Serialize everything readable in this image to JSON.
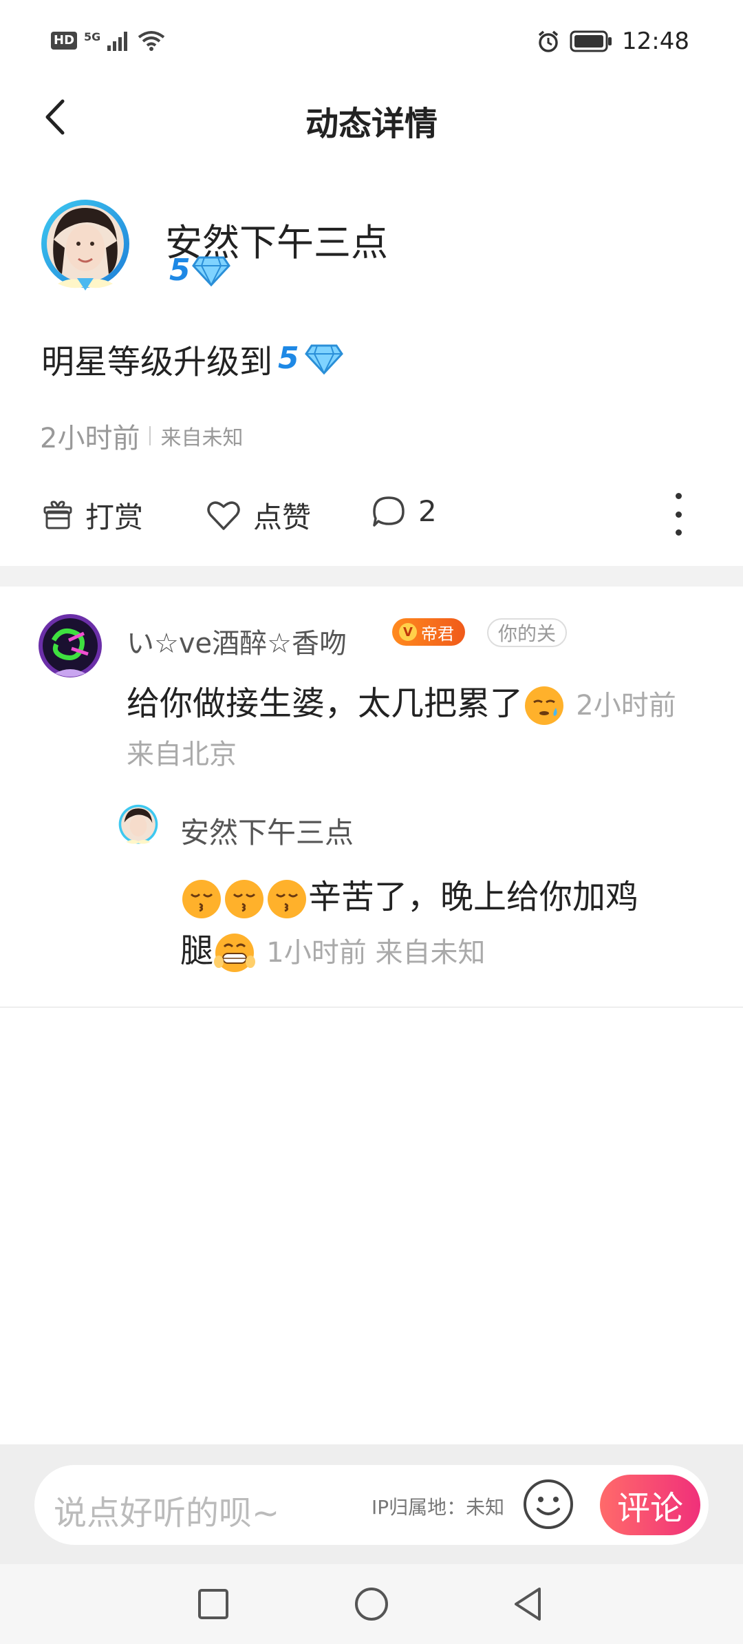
{
  "status_bar": {
    "hd": "HD",
    "network": "5G",
    "time": "12:48",
    "icons": [
      "hd-icon",
      "signal-icon",
      "wifi-icon",
      "alarm-icon",
      "battery-icon"
    ]
  },
  "header": {
    "title": "动态详情",
    "back_icon": "chevron-left-icon"
  },
  "post": {
    "author": "安然下午三点",
    "level_num": "5",
    "content": "明星等级升级到",
    "content_level": "5",
    "time": "2小时前",
    "origin": "来自未知",
    "actions": {
      "reward_label": "打赏",
      "like_label": "点赞",
      "comment_count": "2"
    }
  },
  "comments": [
    {
      "name": "い☆ve酒醉☆香吻",
      "badge": "帝君",
      "badge_icon_text": "V",
      "follow_label": "你的关",
      "text": "给你做接生婆，太几把累了",
      "meta": "2小时前 来自北京",
      "reply": {
        "name": "安然下午三点",
        "text_a": "辛苦了，晚上给你加鸡",
        "text_b": "腿",
        "meta": "1小时前 来自未知"
      }
    }
  ],
  "bottom_bar": {
    "placeholder": "说点好听的呗~",
    "ip_label": "IP归属地：未知",
    "comment_button": "评论"
  },
  "colors": {
    "accent_pink": "#f0307a",
    "level_blue": "#1e88e5",
    "badge_orange": "#f05a1a"
  }
}
